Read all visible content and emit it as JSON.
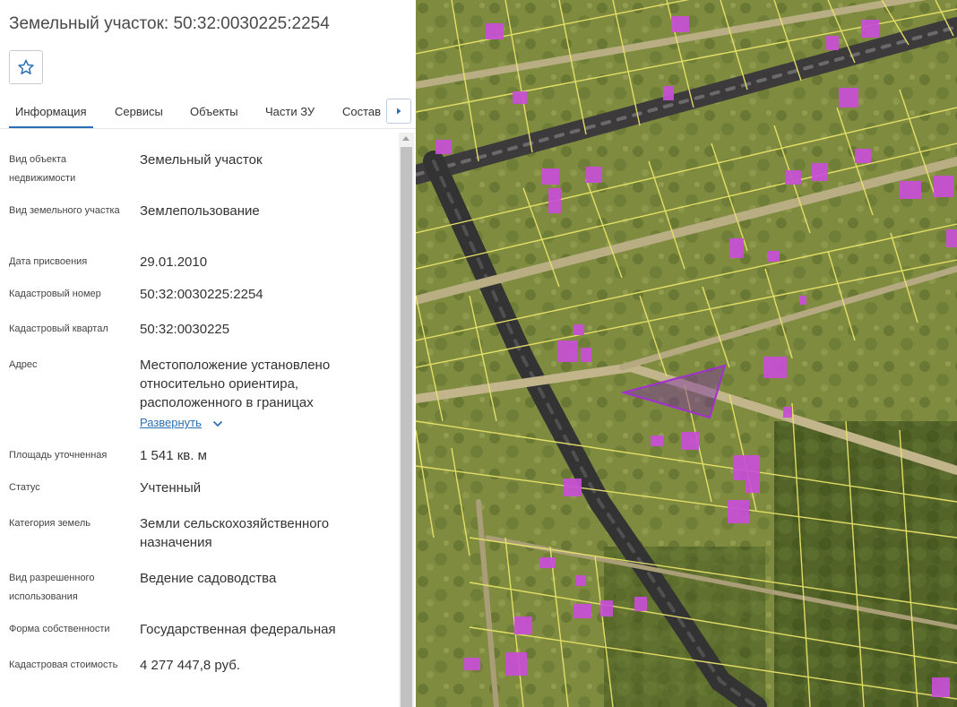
{
  "header": {
    "title": "Земельный участок: 50:32:0030225:2254"
  },
  "favorite": {
    "icon": "star-outline-icon"
  },
  "tabs": [
    {
      "label": "Информация",
      "active": true
    },
    {
      "label": "Сервисы",
      "active": false
    },
    {
      "label": "Объекты",
      "active": false
    },
    {
      "label": "Части ЗУ",
      "active": false
    },
    {
      "label": "Состав",
      "active": false
    }
  ],
  "tabs_next_icon": "caret-right-icon",
  "properties": [
    {
      "label": "Вид объекта недвижимости",
      "value": "Земельный участок"
    },
    {
      "label": "Вид земельного участка",
      "value": "Землепользование"
    },
    {
      "label": "Дата присвоения",
      "value": "29.01.2010"
    },
    {
      "label": "Кадастровый номер",
      "value": "50:32:0030225:2254"
    },
    {
      "label": "Кадастровый квартал",
      "value": "50:32:0030225"
    },
    {
      "label": "Адрес",
      "value": "Местоположение установлено относительно ориентира, расположенного в границах"
    },
    {
      "label": "Площадь уточненная",
      "value": "1 541 кв. м"
    },
    {
      "label": "Статус",
      "value": "Учтенный"
    },
    {
      "label": "Категория земель",
      "value": "Земли сельскохозяйственного назначения"
    },
    {
      "label": "Вид разрешенного использования",
      "value": "Ведение садоводства"
    },
    {
      "label": "Форма собственности",
      "value": "Государственная федеральная"
    },
    {
      "label": "Кадастровая стоимость",
      "value": "4 277 447,8 руб."
    }
  ],
  "address_expand": {
    "label": "Развернуть",
    "icon": "chevron-down-icon"
  },
  "colors": {
    "accent": "#2a6fb4",
    "parcel_outline": "#e9e36a",
    "building_fill": "#c84fd6",
    "selected_parcel": "#7a2fa0"
  }
}
